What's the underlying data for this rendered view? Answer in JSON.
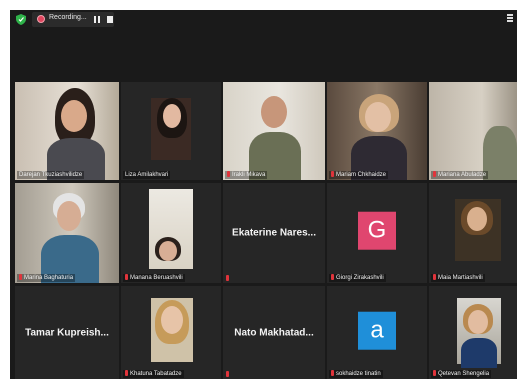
{
  "recording": {
    "label": "Recording..."
  },
  "colors": {
    "active_border": "#c6d93a",
    "mic_muted": "#e0343b",
    "avatar_g": "#e0466f",
    "avatar_a": "#1f8fd9"
  },
  "participants": [
    {
      "name": "Darejan Tkuziashvilidze",
      "video": true,
      "active": true,
      "muted": false
    },
    {
      "name": "Liza Amilakhvari",
      "video": true,
      "muted": false
    },
    {
      "name": "Irakli Mikava",
      "video": true,
      "muted": true
    },
    {
      "name": "Mariam Chkhaidze",
      "video": true,
      "muted": true
    },
    {
      "name": "Mariana Abuladze",
      "video": true,
      "muted": true
    },
    {
      "name": "Marina Baghaturia",
      "video": true,
      "muted": true
    },
    {
      "name": "Manana Beruashvili",
      "video": true,
      "muted": true
    },
    {
      "name": "Ekaterine Nares...",
      "video": false,
      "muted": true
    },
    {
      "name": "Giorgi Zirakashvili",
      "video": false,
      "avatar_letter": "G",
      "muted": true
    },
    {
      "name": "Maia Martiashvili",
      "video": true,
      "muted": true
    },
    {
      "name": "Tamar Kupreish...",
      "video": false,
      "muted": false
    },
    {
      "name": "Khatuna Tabatadze",
      "video": true,
      "muted": true
    },
    {
      "name": "Nato Makhatad...",
      "video": false,
      "muted": true
    },
    {
      "name": "sokhaidze tinatin",
      "video": false,
      "avatar_letter": "a",
      "muted": true
    },
    {
      "name": "Qetevan Shengelia",
      "video": true,
      "muted": true
    }
  ]
}
